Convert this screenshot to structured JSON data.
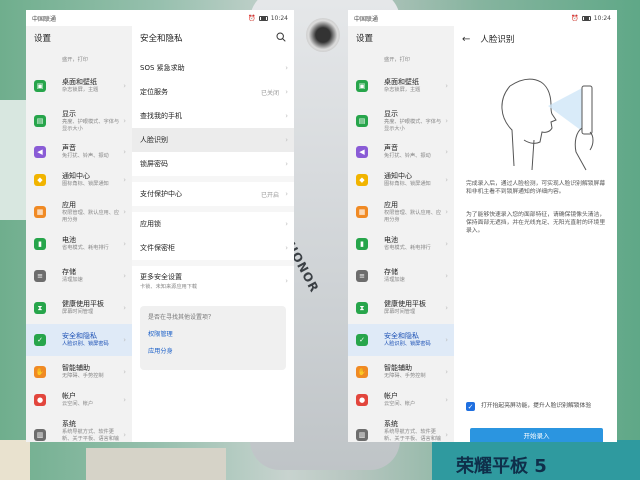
{
  "colors": {
    "accent": "#1f6fe0",
    "button": "#2b95e0",
    "active_bg": "#dfeaf7",
    "active_text": "#1a4fb4"
  },
  "background": {
    "brand_text": "HONOR",
    "box_text": "荣耀平板 5"
  },
  "status_bar": {
    "carrier": "中国联通",
    "time": "10:24"
  },
  "settings": {
    "title": "设置",
    "top_partial_sub": "盛开，打印",
    "items": [
      {
        "title": "桌面和壁纸",
        "sub": "杂志锁屏，主题",
        "icon": "wallpaper-icon",
        "color": "#27a54b"
      },
      {
        "title": "显示",
        "sub": "亮度、护眼模式、字体与显示大小",
        "icon": "display-icon",
        "color": "#27a54b"
      },
      {
        "title": "声音",
        "sub": "免打扰、铃声、振动",
        "icon": "sound-icon",
        "color": "#8a5cd6"
      },
      {
        "title": "通知中心",
        "sub": "图标角标、锁屏通知",
        "icon": "notification-icon",
        "color": "#f1b400"
      },
      {
        "title": "应用",
        "sub": "权限管理、默认应用、应用分身",
        "icon": "apps-icon",
        "color": "#f08a24"
      },
      {
        "title": "电池",
        "sub": "省电模式、耗电排行",
        "icon": "battery-icon",
        "color": "#27a54b"
      },
      {
        "title": "存储",
        "sub": "清理加速",
        "icon": "storage-icon",
        "color": "#6d6d6d"
      },
      {
        "title": "健康使用平板",
        "sub": "屏幕时间管理",
        "icon": "hourglass-icon",
        "color": "#27a54b"
      },
      {
        "title": "安全和隐私",
        "sub": "人脸识别、锁屏密码",
        "icon": "shield-icon",
        "color": "#27a54b"
      },
      {
        "title": "智能辅助",
        "sub": "无障碍、手势控制",
        "icon": "assist-icon",
        "color": "#f08a24"
      },
      {
        "title": "帐户",
        "sub": "云空间、帐户",
        "icon": "account-icon",
        "color": "#e2463d"
      },
      {
        "title": "系统",
        "sub": "系统导航方式、软件更新、关于平板、语言和输入法",
        "icon": "system-icon",
        "color": "#6d6d6d"
      }
    ],
    "active_index": 8
  },
  "security": {
    "title": "安全和隐私",
    "groups": [
      [
        {
          "title": "SOS 紧急求助",
          "value": ""
        },
        {
          "title": "定位服务",
          "value": "已关闭"
        },
        {
          "title": "查找我的手机",
          "value": ""
        },
        {
          "title": "人脸识别",
          "value": ""
        },
        {
          "title": "锁屏密码",
          "value": ""
        }
      ],
      [
        {
          "title": "支付保护中心",
          "value": "已开启"
        }
      ],
      [
        {
          "title": "应用锁",
          "value": ""
        },
        {
          "title": "文件保密柜",
          "value": ""
        }
      ],
      [
        {
          "title": "更多安全设置",
          "sub": "卡锁、未知来源应用下载",
          "value": ""
        }
      ]
    ],
    "suggestion": {
      "question": "是否在寻找其他设置项？",
      "links": [
        "权限管理",
        "应用分身"
      ]
    }
  },
  "face": {
    "title": "人脸识别",
    "desc1": "完成录入后，通过人脸检测，可实现人脸识别解锁屏幕和非机主看不到锁屏通知的详细内容。",
    "desc2": "为了能够快速录入您的面部特征，请确保镜像头清洁，保持面部无遮挡，并在光线充足、无阳光直射的环境里录入。",
    "option": "打开抬起亮屏功能，提升人脸识别解锁体验",
    "option_checked": true,
    "button": "开始录入"
  }
}
